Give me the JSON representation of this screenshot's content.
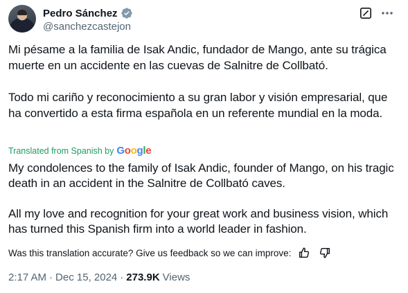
{
  "author": {
    "display_name": "Pedro Sánchez",
    "handle": "@sanchezcastejon",
    "verified_color": "#829aab"
  },
  "post": {
    "original_paragraphs": [
      "Mi pésame a la familia de Isak Andic, fundador de Mango, ante su trágica muerte en un accidente en las cuevas de Salnitre de Collbató.",
      "Todo mi cariño y reconocimiento a su gran labor y visión empresarial, que ha convertido a esta firma española en un referente mundial en la moda."
    ],
    "translation_label": "Translated from Spanish by",
    "translation_provider": "Google",
    "translated_paragraphs": [
      "My condolences to the family of Isak Andic, founder of Mango, on his tragic death in an accident in the Salnitre de Collbató caves.",
      "All my love and recognition for your great work and business vision, which has turned this Spanish firm into a world leader in fashion."
    ]
  },
  "feedback": {
    "prompt": "Was this translation accurate? Give us feedback so we can improve:",
    "like_icon": "thumbs-up-icon",
    "dislike_icon": "thumbs-down-icon"
  },
  "meta": {
    "time": "2:17 AM",
    "separator": "·",
    "date": "Dec 15, 2024",
    "views_count": "273.9K",
    "views_label": "Views"
  },
  "icons": {
    "grok": "grok-icon",
    "more": "more-icon",
    "verified": "verified-badge-icon"
  },
  "colors": {
    "text": "#0f1419",
    "secondary": "#536471",
    "translated_label": "#1d9b64"
  }
}
